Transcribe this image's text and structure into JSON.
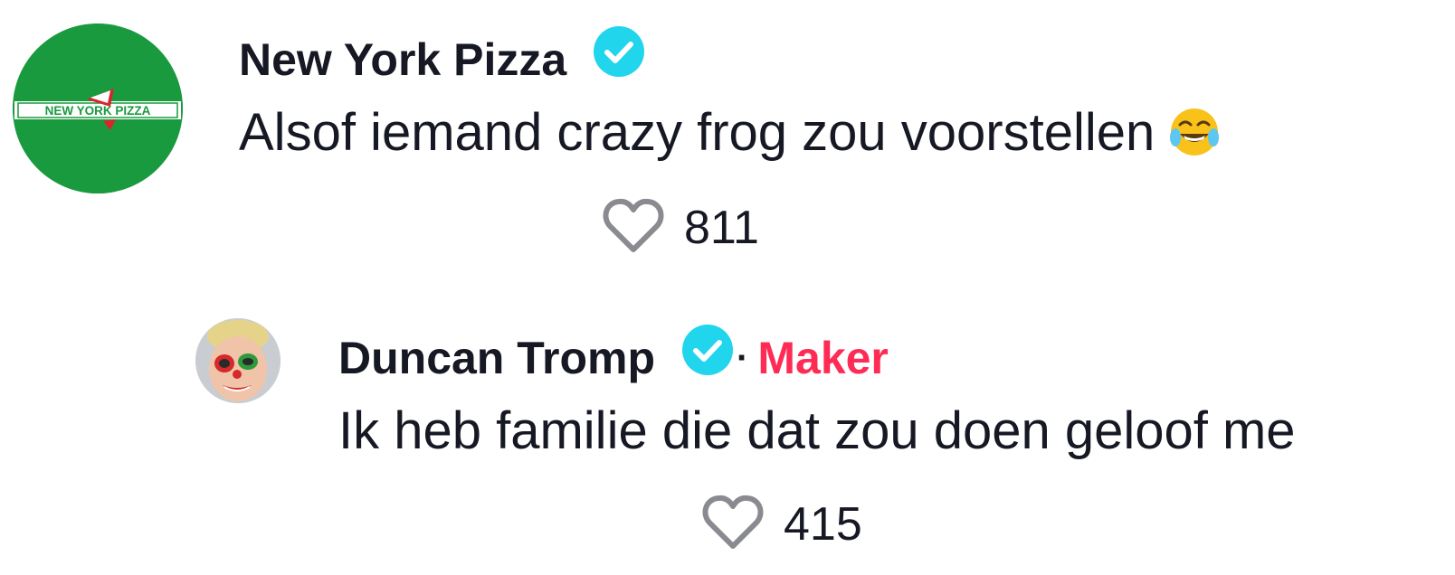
{
  "comments": [
    {
      "username": "New York Pizza",
      "verified": true,
      "text": "Alsof iemand crazy frog zou voorstellen",
      "emoji": "tears-of-joy-emoji",
      "likes": "811",
      "avatar": {
        "logo_text": "NEW YORK PIZZA",
        "background_color": "#1a9a3e",
        "accent_color": "#d8262d"
      }
    },
    {
      "username": "Duncan Tromp",
      "verified": true,
      "creator_separator": "·",
      "creator_label": "Maker",
      "text": "Ik heb familie die dat zou doen geloof me",
      "likes": "415",
      "avatar": {
        "description_icon": "face-paint-avatar"
      }
    }
  ],
  "colors": {
    "verified_badge": "#20d5ec",
    "maker_label": "#fe2c55",
    "text": "#161823",
    "heart_outline": "#8a8b91"
  }
}
